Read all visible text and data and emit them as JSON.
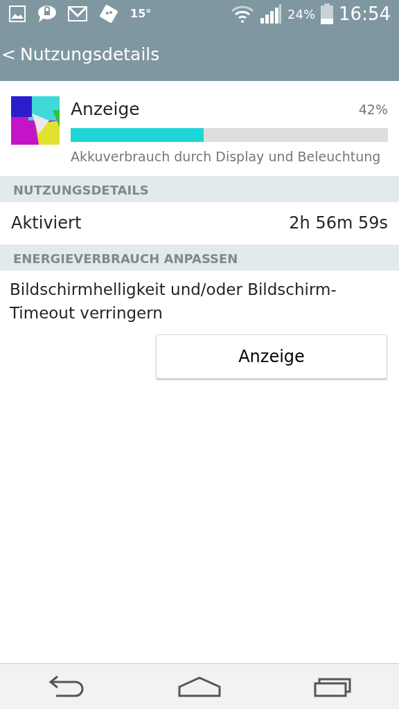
{
  "status_bar": {
    "temperature": "15°",
    "battery": "24%",
    "time": "16:54"
  },
  "header": {
    "back": "<",
    "title": "Nutzungsdetails"
  },
  "app": {
    "name": "Anzeige",
    "percent": "42%",
    "level": 0.42,
    "description": "Akkuverbrauch durch Display und Beleuchtung"
  },
  "sections": [
    {
      "title": "NUTZUNGSDETAILS",
      "rows": [
        {
          "label": "Aktiviert",
          "value": "2h 56m 59s"
        }
      ]
    },
    {
      "title": "ENERGIEVERBRAUCH ANPASSEN",
      "text": "Bildschirmhelligkeit und/oder Bildschirm-Timeout verringern",
      "button": "Anzeige"
    }
  ]
}
